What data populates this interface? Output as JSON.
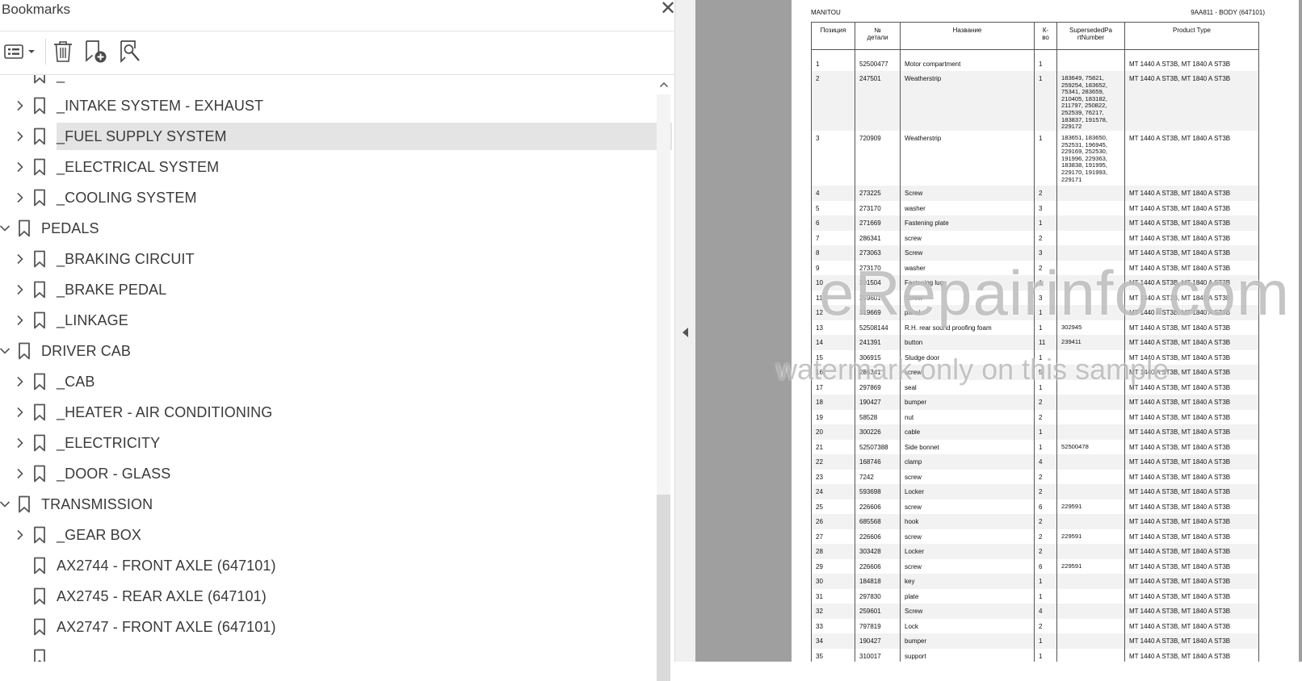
{
  "panel": {
    "title": "Bookmarks",
    "close_glyph": "✕",
    "toolbar": {
      "options": "options-menu-icon",
      "delete": "trash-icon",
      "add": "add-bookmark-icon",
      "find": "find-bookmark-icon"
    }
  },
  "bookmarks": [
    {
      "label": "_",
      "level": 2,
      "expandable": false,
      "partial": true
    },
    {
      "label": "_INTAKE SYSTEM - EXHAUST",
      "level": 2,
      "expandable": true,
      "expanded": false
    },
    {
      "label": "_FUEL SUPPLY SYSTEM",
      "level": 2,
      "expandable": true,
      "expanded": false,
      "selected": true
    },
    {
      "label": "_ELECTRICAL SYSTEM",
      "level": 2,
      "expandable": true,
      "expanded": false
    },
    {
      "label": "_COOLING SYSTEM",
      "level": 2,
      "expandable": true,
      "expanded": false
    },
    {
      "label": "PEDALS",
      "level": 1,
      "expandable": true,
      "expanded": true
    },
    {
      "label": "_BRAKING CIRCUIT",
      "level": 2,
      "expandable": true,
      "expanded": false
    },
    {
      "label": "_BRAKE PEDAL",
      "level": 2,
      "expandable": true,
      "expanded": false
    },
    {
      "label": "_LINKAGE",
      "level": 2,
      "expandable": true,
      "expanded": false
    },
    {
      "label": "DRIVER CAB",
      "level": 1,
      "expandable": true,
      "expanded": true
    },
    {
      "label": "_CAB",
      "level": 2,
      "expandable": true,
      "expanded": false
    },
    {
      "label": "_HEATER - AIR CONDITIONING",
      "level": 2,
      "expandable": true,
      "expanded": false
    },
    {
      "label": "_ELECTRICITY",
      "level": 2,
      "expandable": true,
      "expanded": false
    },
    {
      "label": "_DOOR - GLASS",
      "level": 2,
      "expandable": true,
      "expanded": false
    },
    {
      "label": "TRANSMISSION",
      "level": 1,
      "expandable": true,
      "expanded": true
    },
    {
      "label": "_GEAR BOX",
      "level": 2,
      "expandable": true,
      "expanded": false
    },
    {
      "label": "AX2744 - FRONT AXLE (647101)",
      "level": 2,
      "expandable": false
    },
    {
      "label": "AX2745 - REAR AXLE (647101)",
      "level": 2,
      "expandable": false
    },
    {
      "label": "AX2747 - FRONT AXLE (647101)",
      "level": 2,
      "expandable": false
    },
    {
      "label": "",
      "level": 2,
      "expandable": false,
      "partial": true
    }
  ],
  "document": {
    "header_left": "MANITOU",
    "header_right": "9AA811 - BODY (647101)",
    "columns": [
      "Позиция",
      "№ детали",
      "Название",
      "К-во",
      "SupersededPartNumber",
      "Product Type"
    ],
    "column_display": {
      "number": [
        "№",
        "детали"
      ],
      "qty": [
        "К-",
        "во"
      ],
      "superseded": [
        "SupersededPa",
        "rtNumber"
      ]
    },
    "rows": [
      [
        "1",
        "52500477",
        "Motor compartment",
        "1",
        "",
        "MT 1440 A ST3B, MT 1840 A ST3B"
      ],
      [
        "2",
        "247501",
        "Weatherstrip",
        "1",
        "183649, 75821, 259254, 183652, 75341, 283659, 210405, 183182, 211797, 250822, 252539, 76217, 183837, 191578, 229172",
        "MT 1440 A ST3B, MT 1840 A ST3B"
      ],
      [
        "3",
        "720909",
        "Weatherstrip",
        "1",
        "183651, 183650, 252531, 196945, 229169, 252530, 191996, 229363, 183838, 191995, 229170, 191993, 229171",
        "MT 1440 A ST3B, MT 1840 A ST3B"
      ],
      [
        "4",
        "273225",
        "Screw",
        "2",
        "",
        "MT 1440 A ST3B, MT 1840 A ST3B"
      ],
      [
        "5",
        "273170",
        "washer",
        "3",
        "",
        "MT 1440 A ST3B, MT 1840 A ST3B"
      ],
      [
        "6",
        "271669",
        "Fastening plate",
        "1",
        "",
        "MT 1440 A ST3B, MT 1840 A ST3B"
      ],
      [
        "7",
        "286341",
        "screw",
        "2",
        "",
        "MT 1440 A ST3B, MT 1840 A ST3B"
      ],
      [
        "8",
        "273063",
        "Screw",
        "3",
        "",
        "MT 1440 A ST3B, MT 1840 A ST3B"
      ],
      [
        "9",
        "273170",
        "washer",
        "2",
        "",
        "MT 1440 A ST3B, MT 1840 A ST3B"
      ],
      [
        "10",
        "301504",
        "Fastening lug",
        "1",
        "",
        "MT 1440 A ST3B, MT 1840 A ST3B"
      ],
      [
        "11",
        "259601",
        "Screw",
        "3",
        "",
        "MT 1440 A ST3B, MT 1840 A ST3B"
      ],
      [
        "12",
        "319669",
        "panel",
        "1",
        "",
        "MT 1440 A ST3B, MT 1840 A ST3B"
      ],
      [
        "13",
        "52508144",
        "R.H. rear sound proofing foam",
        "1",
        "302945",
        "MT 1440 A ST3B, MT 1840 A ST3B"
      ],
      [
        "14",
        "241391",
        "button",
        "11",
        "239411",
        "MT 1440 A ST3B, MT 1840 A ST3B"
      ],
      [
        "15",
        "306915",
        "Sludge door",
        "1",
        "",
        "MT 1440 A ST3B, MT 1840 A ST3B"
      ],
      [
        "16",
        "286341",
        "screw",
        "5",
        "",
        "MT 1440 A ST3B, MT 1840 A ST3B"
      ],
      [
        "17",
        "297869",
        "seal",
        "1",
        "",
        "MT 1440 A ST3B, MT 1840 A ST3B"
      ],
      [
        "18",
        "190427",
        "bumper",
        "2",
        "",
        "MT 1440 A ST3B, MT 1840 A ST3B"
      ],
      [
        "19",
        "58528",
        "nut",
        "2",
        "",
        "MT 1440 A ST3B, MT 1840 A ST3B"
      ],
      [
        "20",
        "300226",
        "cable",
        "1",
        "",
        "MT 1440 A ST3B, MT 1840 A ST3B"
      ],
      [
        "21",
        "52507388",
        "Side bonnet",
        "1",
        "52500478",
        "MT 1440 A ST3B, MT 1840 A ST3B"
      ],
      [
        "22",
        "168746",
        "clamp",
        "4",
        "",
        "MT 1440 A ST3B, MT 1840 A ST3B"
      ],
      [
        "23",
        "7242",
        "screw",
        "2",
        "",
        "MT 1440 A ST3B, MT 1840 A ST3B"
      ],
      [
        "24",
        "593698",
        "Locker",
        "2",
        "",
        "MT 1440 A ST3B, MT 1840 A ST3B"
      ],
      [
        "25",
        "226606",
        "screw",
        "6",
        "229591",
        "MT 1440 A ST3B, MT 1840 A ST3B"
      ],
      [
        "26",
        "685568",
        "hook",
        "2",
        "",
        "MT 1440 A ST3B, MT 1840 A ST3B"
      ],
      [
        "27",
        "226606",
        "screw",
        "2",
        "229591",
        "MT 1440 A ST3B, MT 1840 A ST3B"
      ],
      [
        "28",
        "303428",
        "Locker",
        "2",
        "",
        "MT 1440 A ST3B, MT 1840 A ST3B"
      ],
      [
        "29",
        "226606",
        "screw",
        "6",
        "229591",
        "MT 1440 A ST3B, MT 1840 A ST3B"
      ],
      [
        "30",
        "184818",
        "key",
        "1",
        "",
        "MT 1440 A ST3B, MT 1840 A ST3B"
      ],
      [
        "31",
        "297830",
        "plate",
        "1",
        "",
        "MT 1440 A ST3B, MT 1840 A ST3B"
      ],
      [
        "32",
        "259601",
        "Screw",
        "4",
        "",
        "MT 1440 A ST3B, MT 1840 A ST3B"
      ],
      [
        "33",
        "797819",
        "Lock",
        "2",
        "",
        "MT 1440 A ST3B, MT 1840 A ST3B"
      ],
      [
        "34",
        "190427",
        "bumper",
        "1",
        "",
        "MT 1440 A ST3B, MT 1840 A ST3B"
      ],
      [
        "35",
        "310017",
        "support",
        "1",
        "",
        "MT 1440 A ST3B, MT 1840 A ST3B"
      ]
    ],
    "watermark_main": "eRepairinfo.com",
    "watermark_sub": "watermark only on this sample"
  },
  "colors": {
    "selected_row": "#e4e4e4",
    "viewer_bg": "#9f9f9f",
    "text": "#3a3a3a"
  }
}
